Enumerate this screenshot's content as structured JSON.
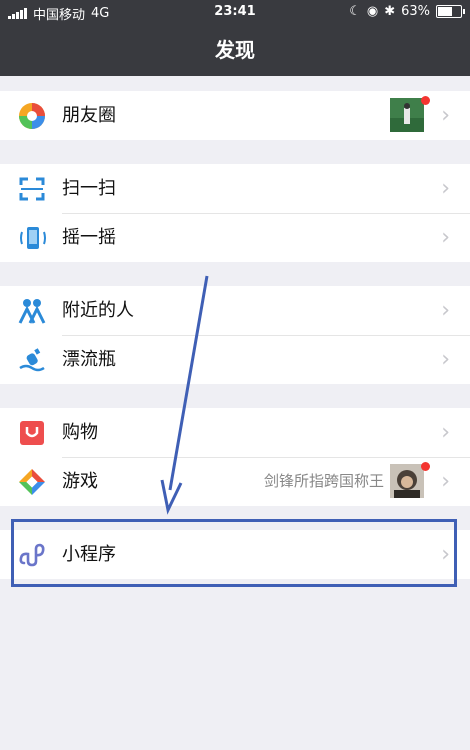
{
  "status_bar": {
    "carrier": "中国移动",
    "network": "4G",
    "time": "23:41",
    "battery_percent": "63%",
    "battery_level": 0.63
  },
  "nav": {
    "title": "发现"
  },
  "groups": [
    {
      "items": [
        {
          "label": "朋友圈",
          "icon": "moments-icon"
        }
      ]
    },
    {
      "items": [
        {
          "label": "扫一扫",
          "icon": "scan-icon"
        },
        {
          "label": "摇一摇",
          "icon": "shake-icon"
        }
      ]
    },
    {
      "items": [
        {
          "label": "附近的人",
          "icon": "people-nearby-icon"
        },
        {
          "label": "漂流瓶",
          "icon": "drift-bottle-icon"
        }
      ]
    },
    {
      "items": [
        {
          "label": "购物",
          "icon": "shopping-icon"
        },
        {
          "label": "游戏",
          "icon": "games-icon",
          "extra": "剑锋所指跨国称王"
        }
      ]
    },
    {
      "items": [
        {
          "label": "小程序",
          "icon": "mini-programs-icon"
        }
      ]
    }
  ],
  "colors": {
    "bar": "#393a3f",
    "background": "#efeff4",
    "badge": "#f43530",
    "annotation": "#3f5fb5"
  }
}
